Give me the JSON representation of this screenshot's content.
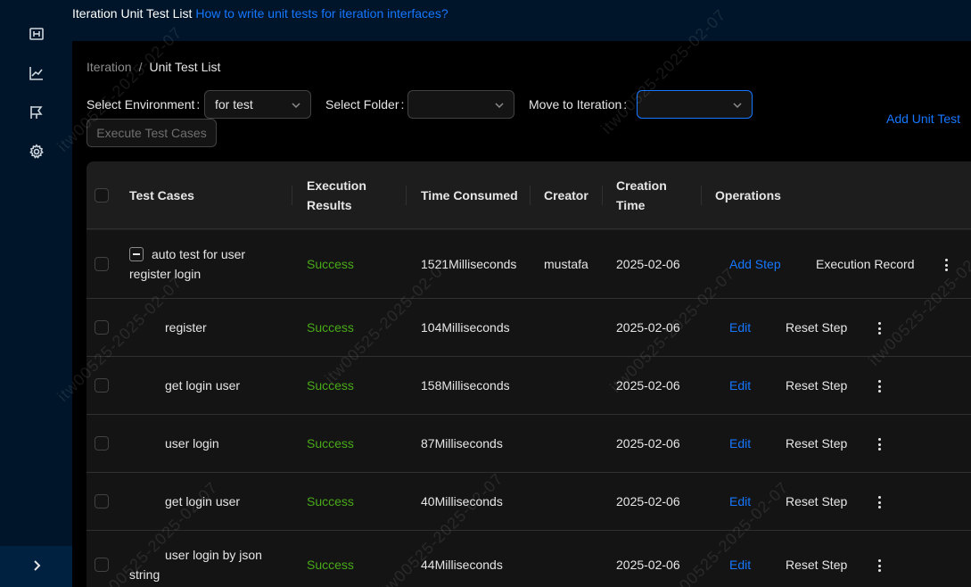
{
  "header": {
    "title": "Iteration Unit Test List",
    "help_link": "How to write unit tests for iteration interfaces?"
  },
  "sidebar": {
    "icons": [
      "dashboard-icon",
      "chart-icon",
      "flag-icon",
      "settings-icon"
    ],
    "collapse_icon": "chevron-right-icon"
  },
  "breadcrumb": {
    "parent": "Iteration",
    "separator": "/",
    "current": "Unit Test List"
  },
  "filters": {
    "environment_label": "Select Environment",
    "environment_value": "for test",
    "folder_label": "Select Folder",
    "folder_value": "",
    "iteration_label": "Move to Iteration",
    "iteration_value": "",
    "colon": ":"
  },
  "actions": {
    "add_unit_test": "Add Unit Test",
    "execute_test_cases": "Execute Test Cases"
  },
  "table": {
    "headers": {
      "test_cases": "Test Cases",
      "execution_results_1": "Execution",
      "execution_results_2": "Results",
      "time_consumed": "Time Consumed",
      "creator": "Creator",
      "creation_time_1": "Creation",
      "creation_time_2": "Time",
      "operations": "Operations"
    },
    "parent_row": {
      "name_line1": "auto test for user",
      "name_line2": "register login",
      "result": "Success",
      "time": "1521Milliseconds",
      "creator": "mustafa",
      "created": "2025-02-06",
      "op1": "Add Step",
      "op2": "Execution Record"
    },
    "rows": [
      {
        "name": "register",
        "result": "Success",
        "time": "104Milliseconds",
        "created": "2025-02-06",
        "op1": "Edit",
        "op2": "Reset Step"
      },
      {
        "name": "get login user",
        "result": "Success",
        "time": "158Milliseconds",
        "created": "2025-02-06",
        "op1": "Edit",
        "op2": "Reset Step"
      },
      {
        "name": "user login",
        "result": "Success",
        "time": "87Milliseconds",
        "created": "2025-02-06",
        "op1": "Edit",
        "op2": "Reset Step"
      },
      {
        "name": "get login user",
        "result": "Success",
        "time": "40Milliseconds",
        "created": "2025-02-06",
        "op1": "Edit",
        "op2": "Reset Step"
      },
      {
        "name_line1": "user login by json",
        "name_line2": "string",
        "result": "Success",
        "time": "44Milliseconds",
        "created": "2025-02-06",
        "op1": "Edit",
        "op2": "Reset Step"
      }
    ]
  },
  "watermark": {
    "text": "itw00525-2025-02-07"
  },
  "colors": {
    "accent": "#1677ff",
    "success": "#49aa19",
    "sidebar": "#001529"
  }
}
